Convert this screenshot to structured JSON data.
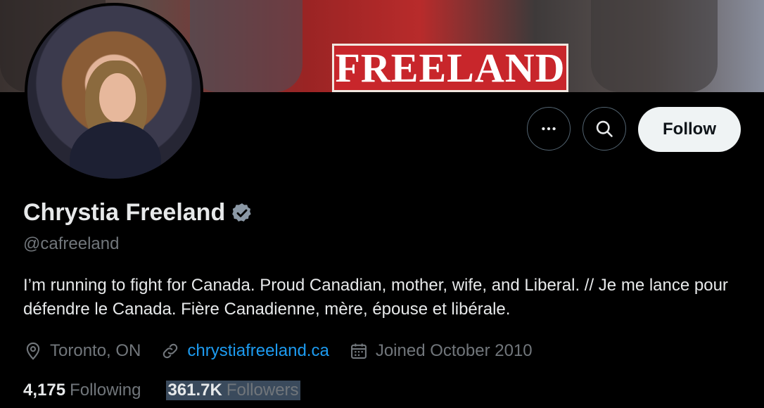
{
  "banner": {
    "sign_text": "FREELAND"
  },
  "profile": {
    "name": "Chrystia Freeland",
    "handle": "@cafreeland",
    "verified": true,
    "bio": "I’m running to fight for Canada. Proud Canadian, mother, wife, and Liberal. // Je me lance pour défendre le Canada. Fière Canadienne, mère, épouse et libérale.",
    "location": "Toronto, ON",
    "website": "chrystiafreeland.ca",
    "joined": "Joined October 2010"
  },
  "actions": {
    "more_icon": "more-icon",
    "search_icon": "search-icon",
    "follow_label": "Follow"
  },
  "stats": {
    "following_count": "4,175",
    "following_label": "Following",
    "followers_count": "361.7K",
    "followers_label": "Followers"
  },
  "colors": {
    "background": "#000000",
    "text_primary": "#e7e9ea",
    "text_secondary": "#71767b",
    "link": "#1d9bf0",
    "follow_button_bg": "#eff3f4",
    "sign_red": "#c8262b"
  }
}
